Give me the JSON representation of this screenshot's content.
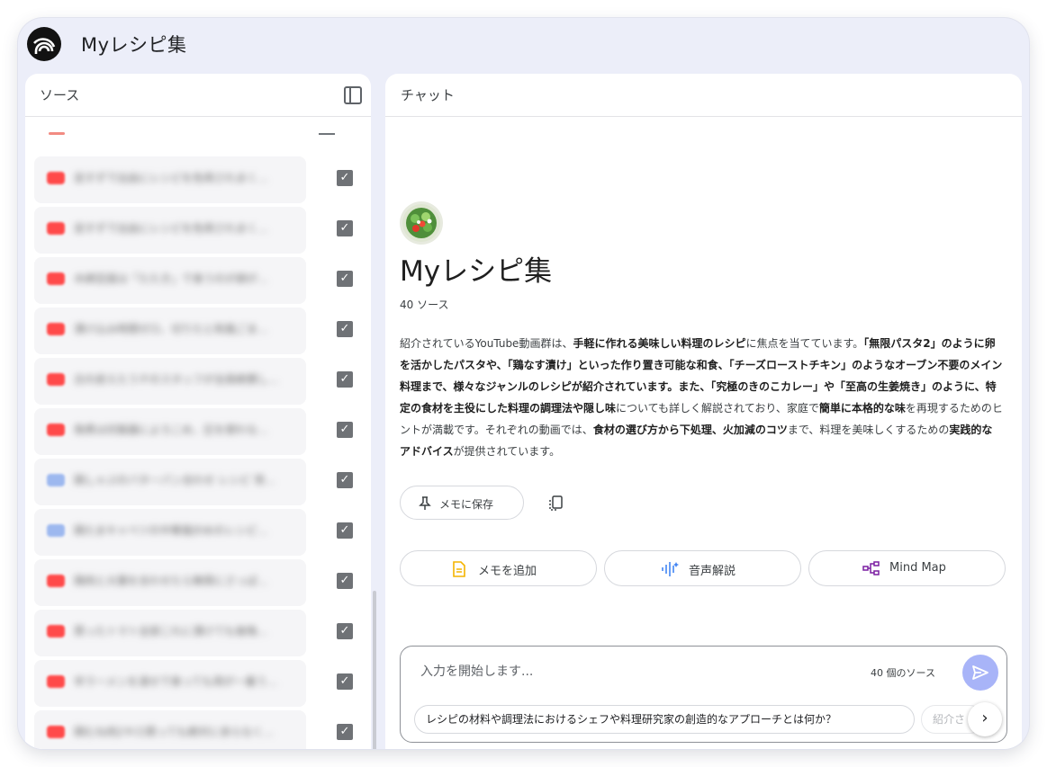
{
  "app": {
    "title": "Myレシピ集",
    "logo_icon": "notebooklm-logo-icon"
  },
  "sources_panel": {
    "title": "ソース",
    "items": [
      {
        "label": "並すずで出由にレシピを色用されまく…",
        "icon": "youtube-icon",
        "checked": true
      },
      {
        "label": "並すずで出由にレシピを色用されまく…",
        "icon": "youtube-icon",
        "checked": true
      },
      {
        "label": "木綿豆腐は「たたき」で食うのが諦が…",
        "icon": "youtube-icon",
        "checked": true
      },
      {
        "label": "漬け込み時間ゼロ、切りたと和風ごま…",
        "icon": "youtube-icon",
        "checked": true
      },
      {
        "label": "古の皮えたうチのスタッフが全員絶賛し…",
        "icon": "youtube-icon",
        "checked": true
      },
      {
        "label": "角煮は炊飯器によろこめ、圧を使わな…",
        "icon": "youtube-icon",
        "checked": true
      },
      {
        "label": "鶏しゃぶのバターパン合わせ レシピ 常…",
        "icon": "doc-icon",
        "checked": true
      },
      {
        "label": "鶏たまキャベツの中華風炒めのレシピ…",
        "icon": "doc-icon",
        "checked": true
      },
      {
        "label": "鶏肉と大葉を合わせたら無限にさっぱ…",
        "icon": "youtube-icon",
        "checked": true
      },
      {
        "label": "買ったトマト全部これに漬けても後悔…",
        "icon": "youtube-icon",
        "checked": true
      },
      {
        "label": "辛ラーメンを湯せで食っても用が一番う…",
        "icon": "youtube-icon",
        "checked": true
      },
      {
        "label": "鶏むね肉2キロ買っても絶対に余らなく…",
        "icon": "youtube-icon",
        "checked": true
      }
    ]
  },
  "chat_panel": {
    "title": "チャット",
    "notebook_emoji": "salad-icon",
    "notebook_title": "Myレシピ集",
    "source_count": "40 ソース",
    "summary": {
      "s1": "紹介されているYouTube動画群は、",
      "s2": "手軽に作れる美味しい料理のレシピ",
      "s3": "に焦点を当てています。",
      "s4": "「無限パスタ2」のように卵を活かしたパスタや、「鶏なす漬け」といった作り置き可能な和食、「チーズローストチキン」のようなオーブン不要のメイン料理まで、様々なジャンルのレシピが紹介されています。また、「究極のきのこカレー」や「至高の生姜焼き」のように、特定の食材を主役にした料理の調理法や隠し味",
      "s5": "についても詳しく解説されており、家庭で",
      "s6": "簡単に本格的な味",
      "s7": "を再現するためのヒントが満載です。それぞれの動画では、",
      "s8": "食材の選び方から下処理、火加減のコツ",
      "s9": "まで、料理を美味しくするための",
      "s10": "実践的なアドバイス",
      "s11": "が提供されています。"
    },
    "save_memo_label": "メモに保存",
    "actions": [
      {
        "label": "メモを追加",
        "icon": "note-icon",
        "color": "#f4b400"
      },
      {
        "label": "音声解説",
        "icon": "audio-wave-icon",
        "color": "#4285f4"
      },
      {
        "label": "Mind Map",
        "icon": "mind-map-icon",
        "color": "#7b1fa2"
      }
    ],
    "input": {
      "placeholder": "入力を開始します...",
      "source_count": "40 個のソース"
    },
    "suggestions": [
      "レシピの材料や調理法におけるシェフや料理研究家の創造的なアプローチとは何か？",
      "紹介さ"
    ]
  }
}
